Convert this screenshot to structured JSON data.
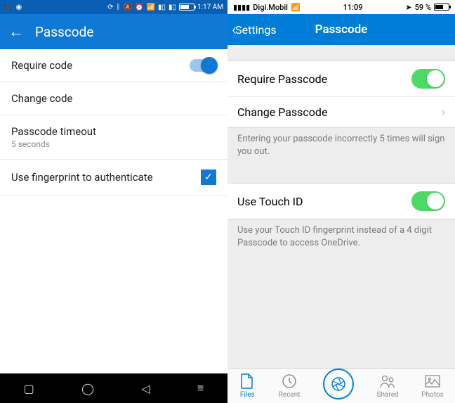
{
  "android": {
    "status": {
      "time": "1:17 AM"
    },
    "header": {
      "title": "Passcode"
    },
    "rows": {
      "require": "Require code",
      "change": "Change code",
      "timeout": {
        "label": "Passcode timeout",
        "value": "5 seconds"
      },
      "fingerprint": "Use fingerprint to authenticate"
    }
  },
  "ios": {
    "status": {
      "carrier": "Digi.Mobil",
      "time": "11:09",
      "battery": "59 %"
    },
    "header": {
      "back": "Settings",
      "title": "Passcode"
    },
    "cells": {
      "require": "Require Passcode",
      "change": "Change Passcode",
      "touchid": "Use Touch ID"
    },
    "footers": {
      "attempts": "Entering your passcode incorrectly 5 times will sign you out.",
      "touchid": "Use your Touch ID fingerprint instead of a 4 digit Passcode to access OneDrive."
    },
    "tabs": {
      "files": "Files",
      "recent": "Recent",
      "shared": "Shared",
      "photos": "Photos"
    }
  }
}
